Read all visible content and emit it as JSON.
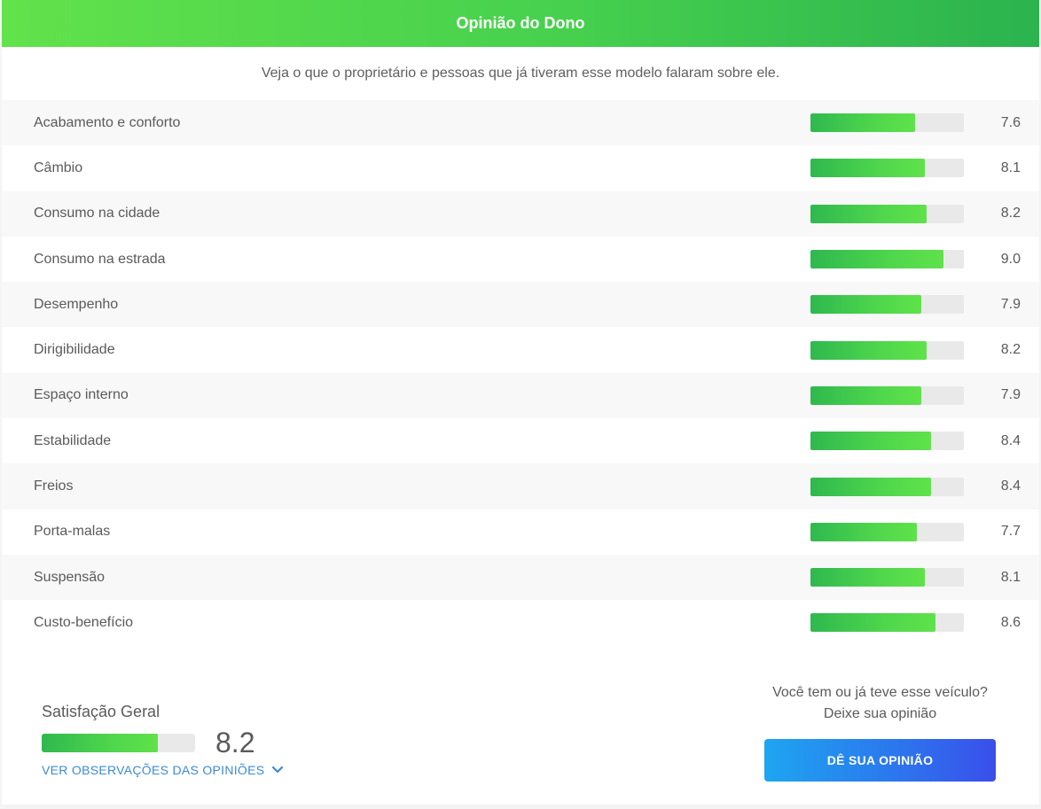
{
  "header": {
    "title": "Opinião do Dono"
  },
  "subtitle": "Veja o que o proprietário e pessoas que já tiveram esse modelo falaram sobre ele.",
  "ratings": [
    {
      "label": "Acabamento e conforto",
      "score": "7.6",
      "value": 7.6
    },
    {
      "label": "Câmbio",
      "score": "8.1",
      "value": 8.1
    },
    {
      "label": "Consumo na cidade",
      "score": "8.2",
      "value": 8.2
    },
    {
      "label": "Consumo na estrada",
      "score": "9.0",
      "value": 9.0
    },
    {
      "label": "Desempenho",
      "score": "7.9",
      "value": 7.9
    },
    {
      "label": "Dirigibilidade",
      "score": "8.2",
      "value": 8.2
    },
    {
      "label": "Espaço interno",
      "score": "7.9",
      "value": 7.9
    },
    {
      "label": "Estabilidade",
      "score": "8.4",
      "value": 8.4
    },
    {
      "label": "Freios",
      "score": "8.4",
      "value": 8.4
    },
    {
      "label": "Porta-malas",
      "score": "7.7",
      "value": 7.7
    },
    {
      "label": "Suspensão",
      "score": "8.1",
      "value": 8.1
    },
    {
      "label": "Custo-benefício",
      "score": "8.6",
      "value": 8.6
    }
  ],
  "overall": {
    "title": "Satisfação Geral",
    "score": "8.2",
    "value": 8.2,
    "link_label": "VER OBSERVAÇÕES DAS OPINIÕES",
    "link_icon": "chevron-down-icon"
  },
  "cta": {
    "question": "Você tem ou já teve esse veículo?",
    "prompt": "Deixe sua opinião",
    "button_label": "DÊ SUA OPINIÃO"
  },
  "colors": {
    "header_gradient": [
      "#62e24b",
      "#2bb34e"
    ],
    "bar_fill": "#4fd64c",
    "bar_track": "#e9e9e9",
    "link": "#3b8ad9",
    "button_gradient": [
      "#1ea5f0",
      "#3a4fea"
    ]
  }
}
